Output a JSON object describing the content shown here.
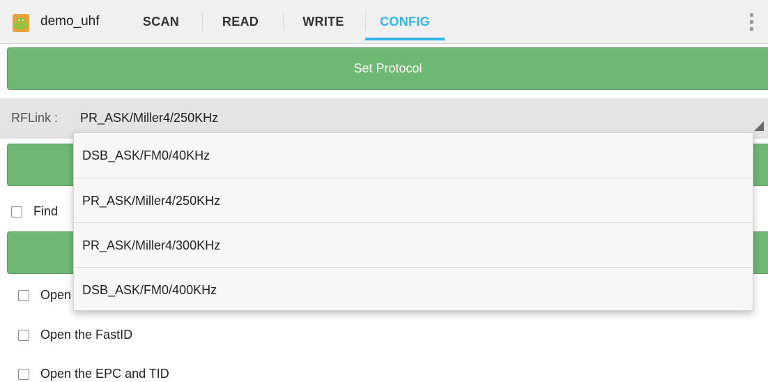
{
  "app": {
    "title": "demo_uhf",
    "icon": "android-icon"
  },
  "tabs": [
    {
      "label": "SCAN"
    },
    {
      "label": "READ"
    },
    {
      "label": "WRITE"
    },
    {
      "label": "CONFIG"
    }
  ],
  "active_tab": "CONFIG",
  "colors": {
    "accent": "#33b5e5",
    "button_green": "#6fb873"
  },
  "protocol_button": {
    "label": "Set Protocol"
  },
  "rflink": {
    "label": "RFLink :",
    "selected": "PR_ASK/Miller4/250KHz"
  },
  "dropdown": {
    "options": [
      "DSB_ASK/FM0/40KHz",
      "PR_ASK/Miller4/250KHz",
      "PR_ASK/Miller4/300KHz",
      "DSB_ASK/FM0/400KHz"
    ]
  },
  "checkboxes": {
    "find_partial": {
      "label": "Find",
      "checked": false
    },
    "open_partial": {
      "label": "Open",
      "checked": false
    },
    "fastid": {
      "label": "Open the FastID",
      "checked": false
    },
    "epc_tid": {
      "label": "Open the EPC and TID",
      "checked": false
    }
  }
}
